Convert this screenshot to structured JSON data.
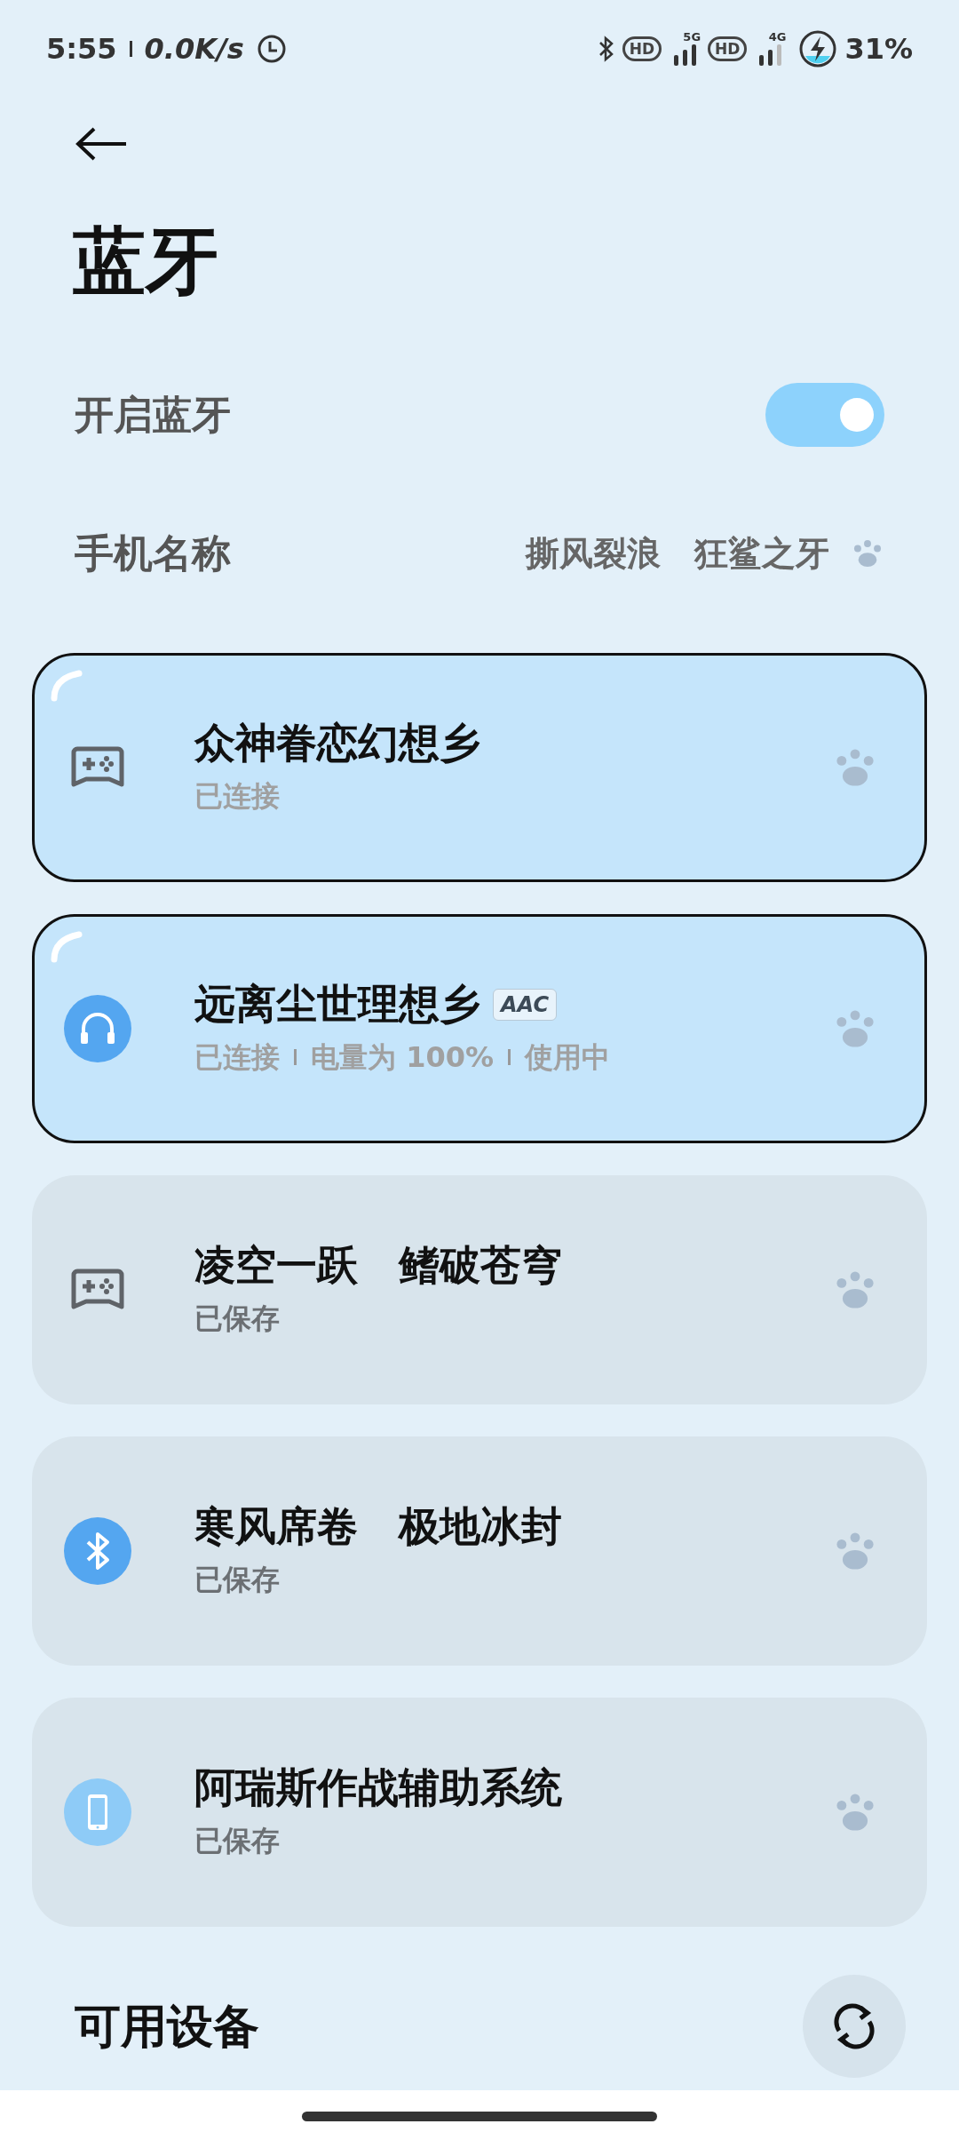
{
  "status_bar": {
    "time": "5:55",
    "speed": "0.0K/s",
    "hd_labels": [
      "HD",
      "HD"
    ],
    "networks": [
      "5G",
      "4G"
    ],
    "battery": "31%"
  },
  "title": "蓝牙",
  "bluetooth_toggle": {
    "label": "开启蓝牙",
    "on": true
  },
  "phone_name": {
    "label": "手机名称",
    "value": "撕风裂浪　狂鲨之牙"
  },
  "devices": [
    {
      "name": "众神眷恋幻想乡",
      "kind": "gamepad",
      "connected": true,
      "status": [
        "已连接"
      ]
    },
    {
      "name": "远离尘世理想乡",
      "kind": "headphones",
      "connected": true,
      "badge": "AAC",
      "status": [
        "已连接",
        "电量为 100%",
        "使用中"
      ]
    },
    {
      "name": "凌空一跃　鳍破苍穹",
      "kind": "gamepad",
      "connected": false,
      "status": [
        "已保存"
      ]
    },
    {
      "name": "寒风席卷　极地冰封",
      "kind": "bluetooth",
      "connected": false,
      "status": [
        "已保存"
      ]
    },
    {
      "name": "阿瑞斯作战辅助系统",
      "kind": "phone",
      "connected": false,
      "status": [
        "已保存"
      ]
    }
  ],
  "available_section": {
    "title": "可用设备"
  }
}
